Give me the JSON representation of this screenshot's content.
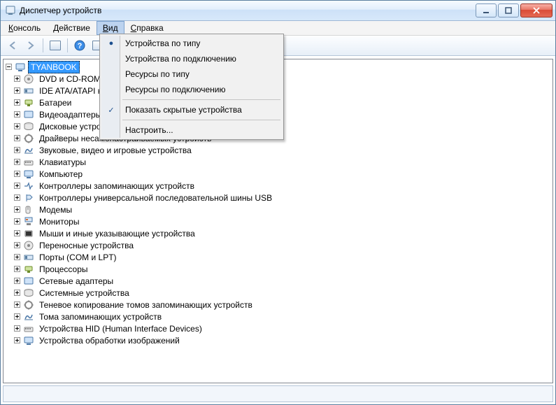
{
  "window": {
    "title": "Диспетчер устройств"
  },
  "menubar": {
    "items": [
      "Консоль",
      "Действие",
      "Вид",
      "Справка"
    ],
    "open_index": 2
  },
  "dropdown": {
    "items": [
      {
        "label": "Устройства по типу",
        "mark": "●"
      },
      {
        "label": "Устройства по подключению",
        "mark": ""
      },
      {
        "label": "Ресурсы по типу",
        "mark": ""
      },
      {
        "label": "Ресурсы по подключению",
        "mark": ""
      },
      {
        "sep": true
      },
      {
        "label": "Показать скрытые устройства",
        "mark": "✓"
      },
      {
        "sep": true
      },
      {
        "label": "Настроить...",
        "mark": ""
      }
    ]
  },
  "toolbar": {
    "back": "back-icon",
    "forward": "forward-icon",
    "show_hide": "show-hide-tree-icon",
    "help": "help-icon",
    "refresh": "refresh-icon"
  },
  "tree": {
    "root": "TYANBOOK",
    "categories": [
      "DVD и CD-ROM дисководы",
      "IDE ATA/ATAPI контроллеры",
      "Батареи",
      "Видеоадаптеры",
      "Дисковые устройства",
      "Драйверы несамонастраиваемых устройств",
      "Звуковые, видео и игровые устройства",
      "Клавиатуры",
      "Компьютер",
      "Контроллеры запоминающих устройств",
      "Контроллеры универсальной последовательной шины USB",
      "Модемы",
      "Мониторы",
      "Мыши и иные указывающие устройства",
      "Переносные устройства",
      "Порты (COM и LPT)",
      "Процессоры",
      "Сетевые адаптеры",
      "Системные устройства",
      "Теневое копирование томов запоминающих устройств",
      "Тома запоминающих устройств",
      "Устройства HID (Human Interface Devices)",
      "Устройства обработки изображений"
    ]
  }
}
